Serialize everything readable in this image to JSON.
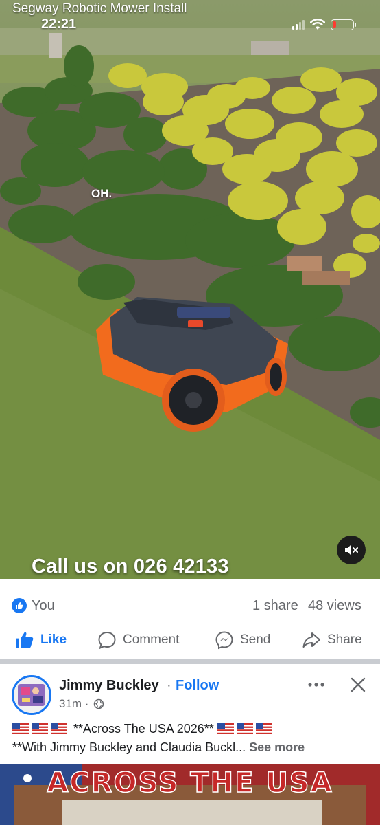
{
  "video": {
    "title": "Segway Robotic Mower Install",
    "caption_oh": "OH.",
    "caption_call": "Call us on 026 42133",
    "mute_icon": "speaker-muted-icon"
  },
  "status_bar": {
    "time": "22:21",
    "battery_color": "#ff3b30"
  },
  "reactions": {
    "reactor": "You",
    "shares": "1 share",
    "views": "48 views"
  },
  "actions": {
    "like": "Like",
    "comment": "Comment",
    "send": "Send",
    "share": "Share"
  },
  "post": {
    "author": "Jimmy Buckley",
    "separator": "·",
    "follow": "Follow",
    "time": "31m ·",
    "line1_text": "**Across The USA 2026**",
    "line2_text": "**With Jimmy Buckley and Claudia Buckl...",
    "see_more": "See more",
    "image_banner": "ACROSS THE USA"
  },
  "colors": {
    "accent": "#1877f2",
    "secondary_text": "#65676b",
    "mower_orange": "#f26b1d"
  }
}
